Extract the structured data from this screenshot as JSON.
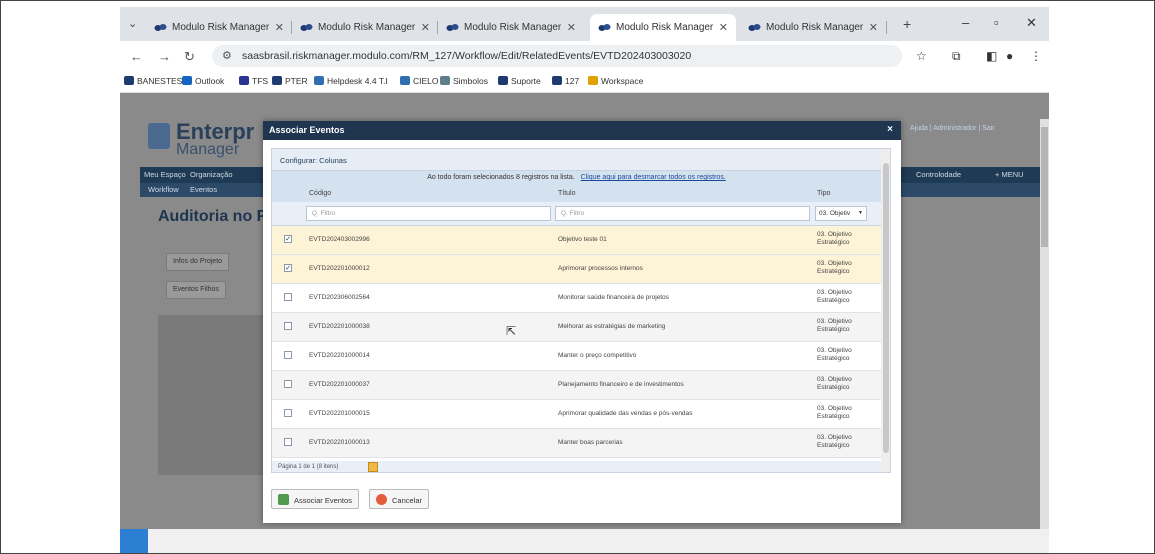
{
  "browser": {
    "tabs": [
      {
        "label": "Modulo Risk Manager",
        "active": false
      },
      {
        "label": "Modulo Risk Manager",
        "active": false
      },
      {
        "label": "Modulo Risk Manager",
        "active": false
      },
      {
        "label": "Modulo Risk Manager",
        "active": true
      },
      {
        "label": "Modulo Risk Manager",
        "active": false
      }
    ],
    "new_tab": "+",
    "minimize": "–",
    "maximize": "▫",
    "close": "✕",
    "url": "saasbrasil.riskmanager.modulo.com/RM_127/Workflow/Edit/RelatedEvents/EVTD202403003020",
    "bookmarks": [
      "BANESTES",
      "Outlook",
      "TFS",
      "PTER",
      "Helpdesk 4.4 T.I",
      "CIELO",
      "Simbolos",
      "Suporte",
      "127",
      "Workspace"
    ]
  },
  "underlying": {
    "logo_line1": "Enterpr",
    "logo_line2": "Manager",
    "nav_items": [
      "Meu Espaço",
      "Organização"
    ],
    "subnav_items": [
      "Workflow",
      "Eventos"
    ],
    "page_title": "Auditoria no F",
    "right_links": "Ajuda | Administrador | Sair",
    "buttons": [
      "Infos do Projeto",
      "Eventos Filhos"
    ],
    "right_tabs": [
      "Controlodade",
      "+ MENU"
    ]
  },
  "modal": {
    "title": "Associar Eventos",
    "close": "×",
    "config_label": "Configurar: Colunas",
    "selection_text": "Ao todo foram selecionados 8 registros na lista.",
    "selection_link": "Clique aqui para desmarcar todos os registros.",
    "columns": {
      "code": "Código",
      "title": "Título",
      "type": "Tipo"
    },
    "filters": {
      "code_placeholder": "Q. Filtro",
      "title_placeholder": "Q. Filtro",
      "type_value": "03. Objetiv"
    },
    "rows": [
      {
        "checked": true,
        "code": "EVTD202403002996",
        "title": "Objetivo teste 01",
        "type": "03. Objetivo Estratégico"
      },
      {
        "checked": true,
        "code": "EVTD202201000012",
        "title": "Aprimorar processos internos",
        "type": "03. Objetivo Estratégico"
      },
      {
        "checked": false,
        "code": "EVTD202306002564",
        "title": "Monitorar saúde financeira de projetos",
        "type": "03. Objetivo Estratégico"
      },
      {
        "checked": false,
        "code": "EVTD202201000038",
        "title": "Melhorar as estratégias de marketing",
        "type": "03. Objetivo Estratégico"
      },
      {
        "checked": false,
        "code": "EVTD202201000014",
        "title": "Manter o preço competitivo",
        "type": "03. Objetivo Estratégico"
      },
      {
        "checked": false,
        "code": "EVTD202201000037",
        "title": "Planejamento financeiro e de investimentos",
        "type": "03. Objetivo Estratégico"
      },
      {
        "checked": false,
        "code": "EVTD202201000015",
        "title": "Aprimorar qualidade das vendas e pós-vendas",
        "type": "03. Objetivo Estratégico"
      },
      {
        "checked": false,
        "code": "EVTD202201000013",
        "title": "Manter boas parcerias",
        "type": "03. Objetivo Estratégico"
      }
    ],
    "pager": "Página 1 de 1 (8 itens)",
    "associate_button": "Associar Eventos",
    "cancel_button": "Cancelar"
  }
}
